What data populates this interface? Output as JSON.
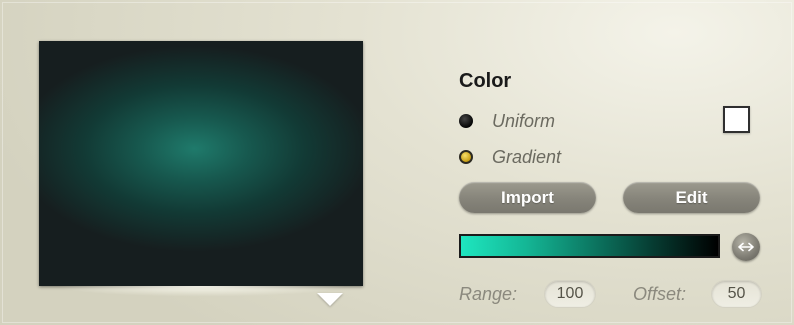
{
  "color_panel": {
    "heading": "Color",
    "mode_options": [
      {
        "label": "Uniform",
        "selected": false
      },
      {
        "label": "Gradient",
        "selected": true
      }
    ],
    "uniform_swatch_color": "#ffffff",
    "buttons": {
      "import_label": "Import",
      "edit_label": "Edit"
    },
    "gradient": {
      "start_color": "#1ee6bf",
      "end_color": "#000000",
      "swap_icon": "swap-horizontal-icon"
    },
    "range": {
      "label": "Range:",
      "value": "100"
    },
    "offset": {
      "label": "Offset:",
      "value": "50"
    }
  },
  "preview": {
    "center_color": "#1f7a6b",
    "edge_color": "#161e1f",
    "dropdown_icon": "triangle-down-icon"
  }
}
